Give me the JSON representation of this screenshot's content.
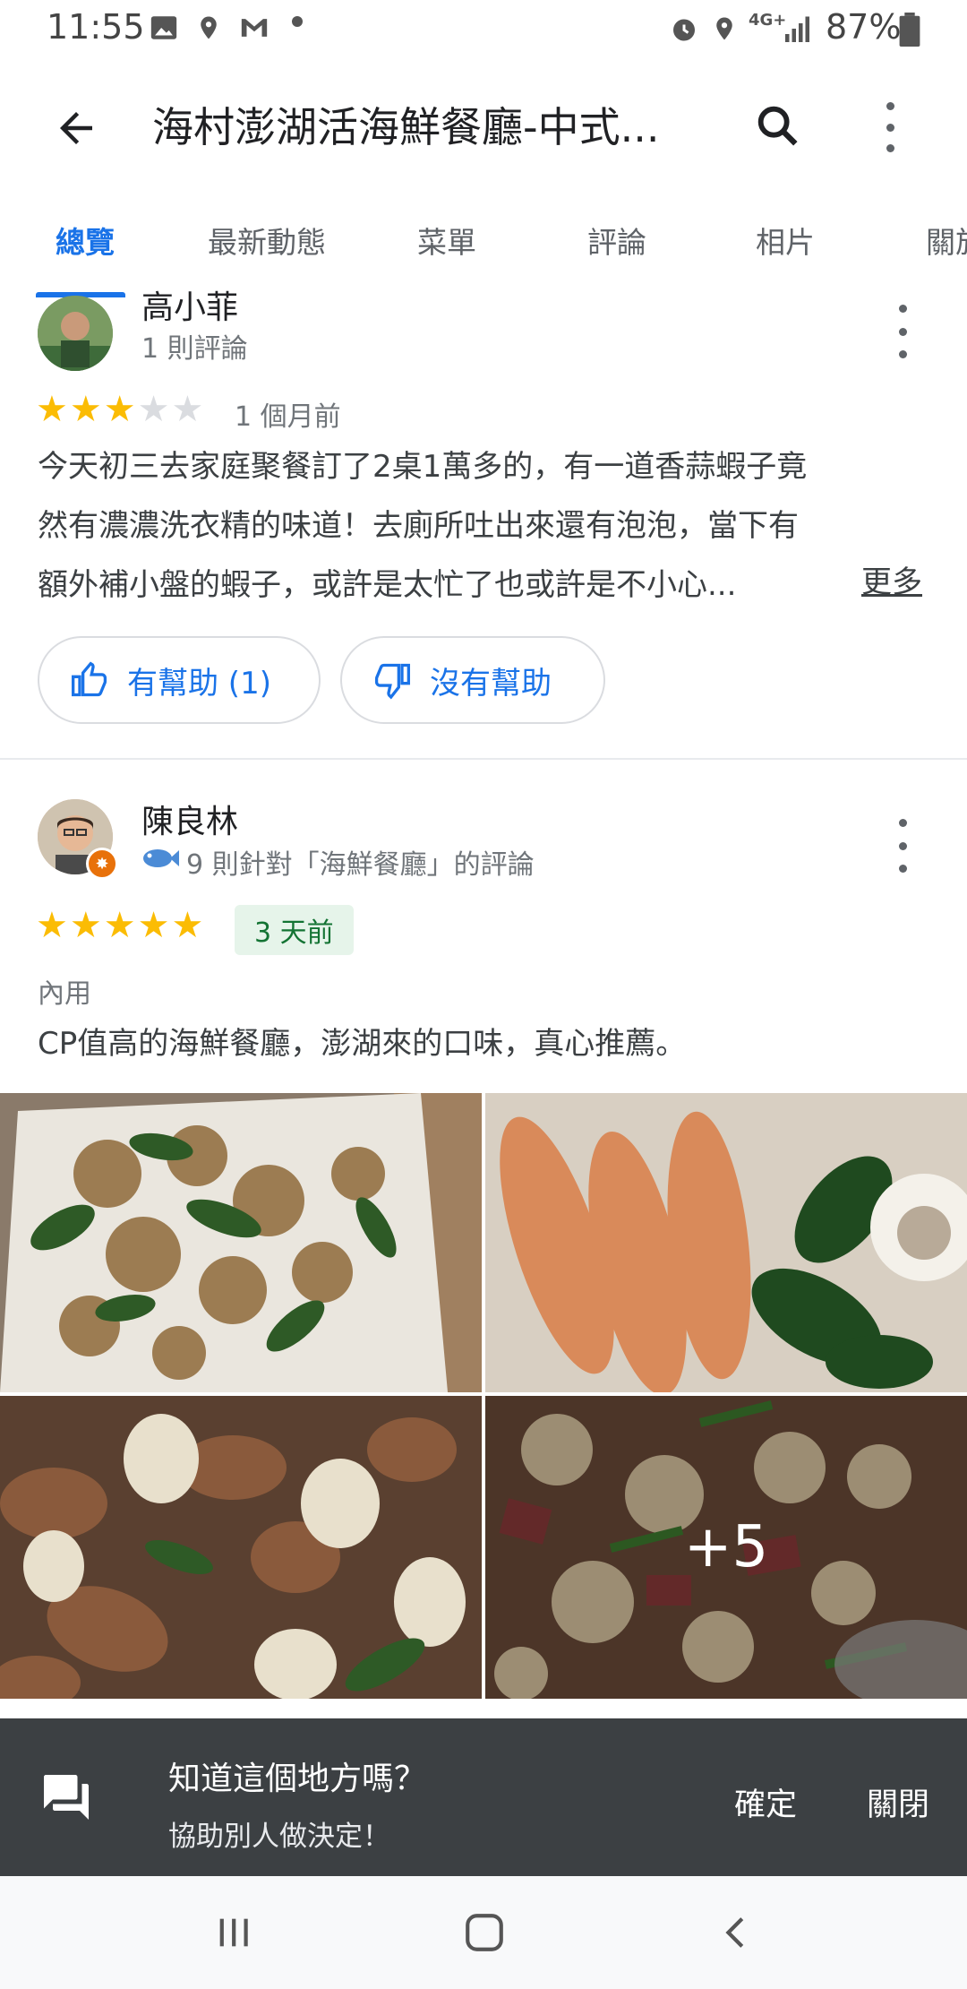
{
  "status_bar": {
    "time": "11:55",
    "battery": "87%",
    "network": "4G+"
  },
  "app_bar": {
    "title": "海村澎湖活海鮮餐廳-中式...",
    "back_icon": "arrow-back-icon",
    "search_icon": "search-icon",
    "more_icon": "more-vert-icon"
  },
  "tabs": [
    {
      "label": "總覽",
      "active": true
    },
    {
      "label": "最新動態",
      "active": false
    },
    {
      "label": "菜單",
      "active": false
    },
    {
      "label": "評論",
      "active": false
    },
    {
      "label": "相片",
      "active": false
    },
    {
      "label": "關於",
      "active": false
    }
  ],
  "reviews": [
    {
      "name": "高小菲",
      "meta": "1 則評論",
      "rating": 3,
      "when": "1 個月前",
      "text_lines": [
        "今天初三去家庭聚餐訂了2桌1萬多的，有一道香蒜蝦子竟",
        "然有濃濃洗衣精的味道！去廁所吐出來還有泡泡，當下有",
        "額外補小盤的蝦子，或許是太忙了也或許是不小心..."
      ],
      "more_label": "更多",
      "helpful_label": "有幫助 (1)",
      "not_helpful_label": "沒有幫助"
    },
    {
      "name": "陳良林",
      "meta": "9 則針對「海鮮餐廳」的評論",
      "rating": 5,
      "when": "3 天前",
      "dining": "內用",
      "text": "CP值高的海鮮餐廳，澎湖來的口味，真心推薦。",
      "more_photos": "+5"
    }
  ],
  "snackbar": {
    "question": "知道這個地方嗎？",
    "subtitle": "協助別人做決定！",
    "confirm_label": "確定",
    "close_label": "關閉"
  },
  "colors": {
    "accent": "#1a73e8",
    "star": "#fbbc04",
    "snackbar_bg": "#3c4043",
    "badge_bg": "#e6f4ea",
    "badge_text": "#137333"
  }
}
